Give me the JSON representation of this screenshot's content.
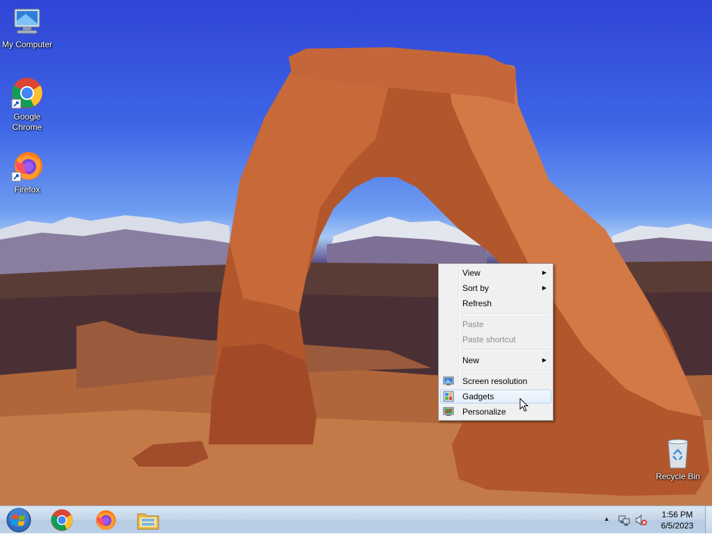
{
  "desktop": {
    "icons": [
      {
        "label": "My Computer"
      },
      {
        "label": "Google Chrome"
      },
      {
        "label": "Firefox"
      },
      {
        "label": "Recycle Bin"
      }
    ]
  },
  "context_menu": {
    "items": [
      {
        "label": "View",
        "submenu": true
      },
      {
        "label": "Sort by",
        "submenu": true
      },
      {
        "label": "Refresh"
      },
      {
        "label": "Paste",
        "disabled": true
      },
      {
        "label": "Paste shortcut",
        "disabled": true
      },
      {
        "label": "New",
        "submenu": true
      },
      {
        "label": "Screen resolution",
        "icon": "monitor-icon"
      },
      {
        "label": "Gadgets",
        "icon": "gadgets-icon",
        "highlighted": true
      },
      {
        "label": "Personalize",
        "icon": "personalize-icon"
      }
    ],
    "submenu_glyph": "▶"
  },
  "taskbar": {
    "pinned": [
      "chrome-icon",
      "firefox-icon",
      "file-explorer-icon"
    ],
    "tray_arrow": "▲",
    "clock": {
      "time": "1:56 PM",
      "date": "6/5/2023"
    }
  }
}
